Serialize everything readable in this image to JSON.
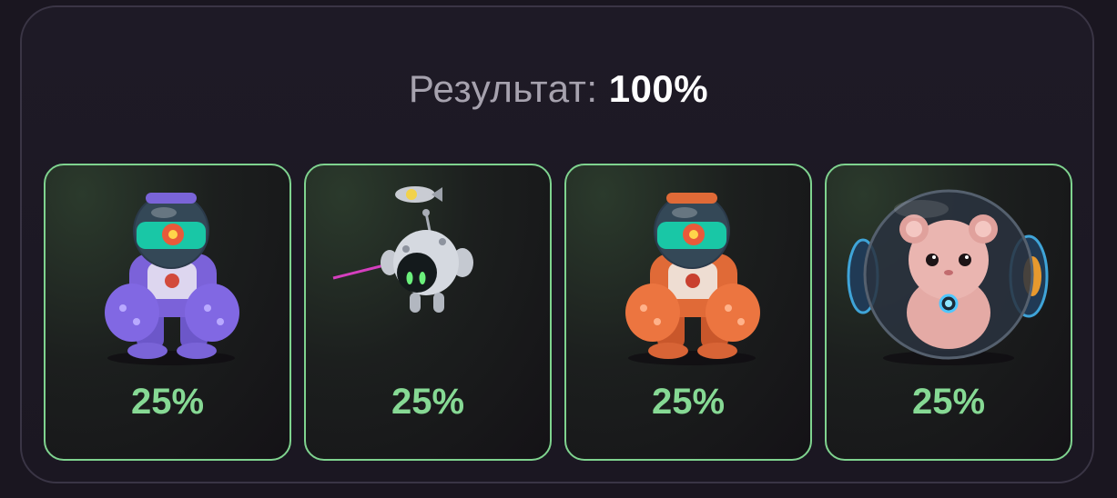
{
  "header": {
    "label": "Результат:",
    "value": "100%"
  },
  "cards": [
    {
      "image": "purple-armored-robot",
      "percent": "25%"
    },
    {
      "image": "flying-drone-robot",
      "percent": "25%"
    },
    {
      "image": "orange-armored-robot",
      "percent": "25%"
    },
    {
      "image": "hamster-in-ball",
      "percent": "25%"
    }
  ],
  "colors": {
    "card_border": "#7fd38f",
    "percent_text": "#86d994",
    "title_label": "#a6a2ae",
    "title_value": "#ffffff"
  }
}
